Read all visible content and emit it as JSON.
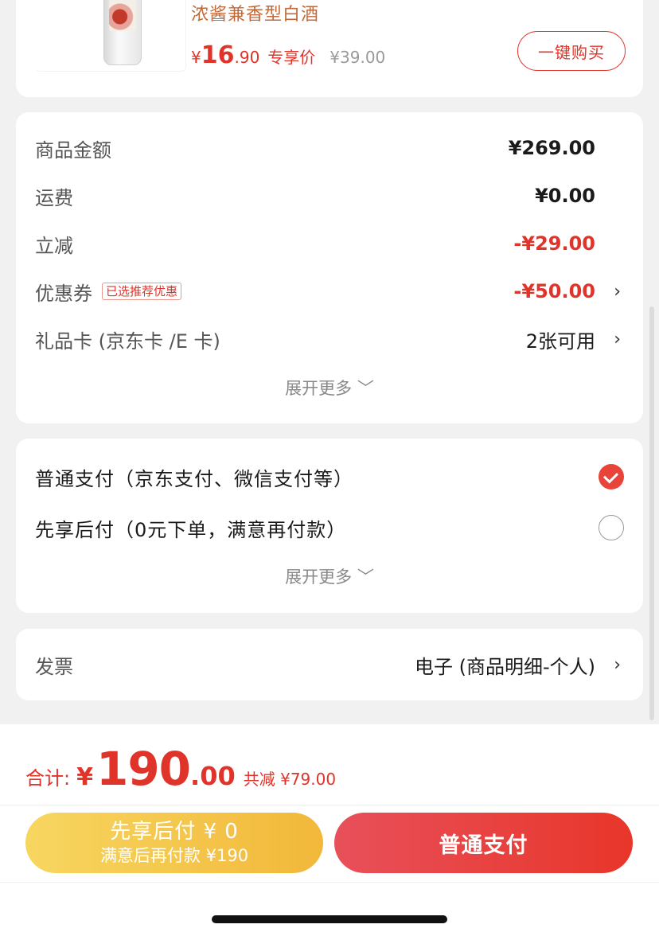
{
  "product": {
    "title": "浓酱兼香型白酒",
    "price_symbol": "¥",
    "price_int": "16",
    "price_dec": ".90",
    "price_tag": "专享价",
    "original_price": "¥39.00",
    "buy_button": "一键购买"
  },
  "summary": {
    "rows": [
      {
        "label": "商品金额",
        "value": "¥269.00"
      },
      {
        "label": "运费",
        "value": "¥0.00"
      },
      {
        "label": "立减",
        "value": "-¥29.00"
      },
      {
        "label": "优惠券",
        "tag": "已选推荐优惠",
        "value": "-¥50.00"
      },
      {
        "label": "礼品卡 (京东卡 /E 卡)",
        "value": "2张可用"
      }
    ],
    "expand": "展开更多 ﹀"
  },
  "payment": {
    "options": [
      {
        "label": "普通支付（京东支付、微信支付等）",
        "selected": true
      },
      {
        "label": "先享后付（0元下单，满意再付款）",
        "selected": false
      }
    ],
    "expand": "展开更多 ﹀"
  },
  "invoice": {
    "label": "发票",
    "value": "电子 (商品明细-个人)"
  },
  "footer": {
    "total_label": "合计:",
    "total_symbol": "¥",
    "total_int": "190",
    "total_dec": ".00",
    "total_saved": "共减 ¥79.00",
    "bnpl_main": "先享后付 ¥ 0",
    "bnpl_sub": "满意后再付款 ¥190",
    "pay_button": "普通支付"
  },
  "colors": {
    "accent": "#e0342a",
    "bnpl_yellow": "#f2c14a",
    "product_title": "#c2693a"
  },
  "icons": [
    "chevron-right-icon",
    "chevron-down-icon",
    "check-icon"
  ]
}
